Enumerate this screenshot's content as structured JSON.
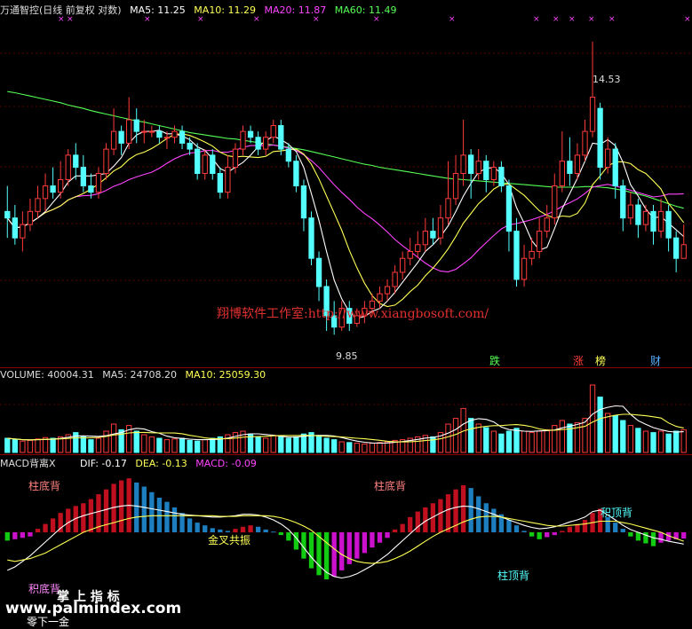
{
  "main_header": {
    "title": "万通智控(日线 前复权 对数)",
    "ma5": "MA5: 11.25",
    "ma10": "MA10: 11.29",
    "ma20": "MA20: 11.87",
    "ma60": "MA60: 11.49"
  },
  "volume_header": {
    "label": "VOLUME: 40004.31",
    "ma5": "MA5: 24708.20",
    "ma10": "MA10: 25059.30"
  },
  "macd_header": {
    "label": "MACD背离X",
    "dif": "DIF: -0.17",
    "dea": "DEA: -0.13",
    "macd": "MACD: -0.09"
  },
  "annotations": {
    "high_price": "14.53",
    "low_price": "9.85",
    "watermark": "翔博软件工作室:http://www.xiangbosoft.com/",
    "tag_die": "跌",
    "tag_zhang": "涨",
    "tag_bang": "榜",
    "tag_cai": "财",
    "zhu_di_bei_1": "柱底背",
    "zhu_di_bei_2": "柱底背",
    "jin_cha_gong_zhen": "金叉共振",
    "zhu_ding_bei": "柱顶背",
    "ji_ding_bei": "积顶背",
    "ji_di_bei": "积底背",
    "logo_text": "掌 上 指 标",
    "site": "www.palmindex.com",
    "bottom_text": "零下一金"
  },
  "colors": {
    "up": "#ff3b3b",
    "down": "#54ffff",
    "ma5": "#ffffff",
    "ma10": "#ffff55",
    "ma20": "#ff44ff",
    "ma60": "#55ff55",
    "macd_red": "#c01020",
    "macd_blue": "#1e7fc0",
    "macd_green": "#11cc11",
    "macd_purple": "#cc11cc"
  },
  "chart_data": {
    "type": "candlestick",
    "scale": "log",
    "y_range": [
      9.5,
      15.0
    ],
    "candles": [
      [
        11.6,
        11.5,
        12.0,
        11.2
      ],
      [
        11.5,
        11.2,
        11.7,
        11.1
      ],
      [
        11.2,
        11.4,
        11.6,
        11.0
      ],
      [
        11.4,
        11.6,
        11.8,
        11.3
      ],
      [
        11.6,
        11.8,
        12.0,
        11.5
      ],
      [
        11.8,
        12.0,
        12.2,
        11.6
      ],
      [
        12.0,
        11.9,
        12.3,
        11.8
      ],
      [
        11.9,
        12.1,
        12.4,
        11.8
      ],
      [
        12.1,
        12.5,
        12.6,
        12.0
      ],
      [
        12.5,
        12.3,
        12.7,
        12.1
      ],
      [
        12.3,
        12.0,
        12.5,
        11.9
      ],
      [
        12.0,
        11.9,
        12.2,
        11.8
      ],
      [
        11.9,
        12.2,
        12.3,
        11.8
      ],
      [
        12.2,
        12.6,
        12.7,
        12.1
      ],
      [
        12.6,
        12.9,
        13.3,
        12.5
      ],
      [
        12.9,
        12.7,
        13.0,
        12.5
      ],
      [
        12.7,
        13.1,
        13.5,
        12.6
      ],
      [
        13.1,
        12.9,
        13.3,
        12.7
      ],
      [
        12.9,
        12.9,
        13.1,
        12.7
      ],
      [
        12.9,
        12.9,
        13.0,
        12.8
      ],
      [
        12.9,
        12.8,
        13.0,
        12.7
      ],
      [
        12.8,
        12.8,
        12.9,
        12.6
      ],
      [
        12.8,
        12.9,
        13.0,
        12.7
      ],
      [
        12.9,
        12.7,
        13.0,
        12.6
      ],
      [
        12.7,
        12.6,
        12.8,
        12.5
      ],
      [
        12.6,
        12.2,
        12.7,
        12.1
      ],
      [
        12.2,
        12.5,
        12.6,
        12.1
      ],
      [
        12.5,
        12.2,
        12.6,
        12.1
      ],
      [
        12.2,
        11.9,
        12.3,
        11.8
      ],
      [
        11.9,
        12.3,
        12.5,
        11.8
      ],
      [
        12.3,
        12.6,
        12.7,
        12.2
      ],
      [
        12.6,
        12.9,
        13.0,
        12.5
      ],
      [
        12.9,
        12.8,
        13.0,
        12.7
      ],
      [
        12.8,
        12.6,
        12.9,
        12.5
      ],
      [
        12.6,
        12.8,
        12.9,
        12.5
      ],
      [
        12.8,
        13.0,
        13.1,
        12.7
      ],
      [
        13.0,
        12.6,
        13.1,
        12.5
      ],
      [
        12.6,
        12.4,
        12.7,
        12.3
      ],
      [
        12.4,
        12.0,
        12.5,
        11.9
      ],
      [
        12.0,
        11.5,
        12.1,
        11.3
      ],
      [
        11.5,
        10.9,
        11.6,
        10.8
      ],
      [
        10.9,
        10.5,
        11.0,
        10.3
      ],
      [
        10.5,
        10.1,
        10.6,
        9.9
      ],
      [
        10.1,
        9.95,
        10.3,
        9.85
      ],
      [
        9.95,
        10.2,
        10.3,
        9.9
      ],
      [
        10.2,
        10.0,
        10.3,
        9.9
      ],
      [
        10.0,
        10.1,
        10.2,
        9.95
      ],
      [
        10.1,
        10.2,
        10.3,
        10.0
      ],
      [
        10.2,
        10.3,
        10.4,
        10.1
      ],
      [
        10.3,
        10.4,
        10.5,
        10.2
      ],
      [
        10.4,
        10.5,
        10.6,
        10.3
      ],
      [
        10.5,
        10.7,
        10.8,
        10.4
      ],
      [
        10.7,
        10.9,
        11.0,
        10.6
      ],
      [
        10.9,
        11.0,
        11.2,
        10.8
      ],
      [
        11.0,
        11.1,
        11.3,
        10.9
      ],
      [
        11.1,
        11.3,
        11.5,
        11.0
      ],
      [
        11.3,
        11.2,
        11.5,
        11.1
      ],
      [
        11.2,
        11.5,
        11.7,
        11.1
      ],
      [
        11.5,
        11.8,
        12.4,
        11.4
      ],
      [
        11.8,
        12.2,
        12.5,
        11.7
      ],
      [
        12.2,
        12.5,
        13.1,
        12.0
      ],
      [
        12.5,
        12.2,
        12.6,
        11.8
      ],
      [
        12.2,
        12.4,
        12.6,
        12.1
      ],
      [
        12.4,
        12.1,
        12.5,
        11.9
      ],
      [
        12.1,
        12.3,
        12.4,
        12.0
      ],
      [
        12.3,
        12.0,
        12.4,
        11.9
      ],
      [
        12.0,
        11.3,
        12.1,
        11.0
      ],
      [
        11.3,
        10.6,
        11.5,
        10.5
      ],
      [
        10.6,
        10.9,
        11.1,
        10.5
      ],
      [
        10.9,
        11.0,
        11.2,
        10.8
      ],
      [
        11.0,
        11.3,
        11.5,
        10.9
      ],
      [
        11.3,
        11.5,
        11.7,
        11.2
      ],
      [
        11.5,
        12.0,
        12.2,
        11.4
      ],
      [
        12.0,
        12.4,
        12.9,
        11.9
      ],
      [
        12.4,
        12.2,
        12.8,
        12.0
      ],
      [
        12.2,
        12.5,
        12.7,
        12.1
      ],
      [
        12.5,
        12.9,
        13.1,
        12.4
      ],
      [
        12.9,
        13.5,
        14.53,
        12.8
      ],
      [
        13.3,
        12.3,
        13.4,
        12.1
      ],
      [
        12.3,
        12.6,
        12.8,
        12.2
      ],
      [
        12.6,
        12.0,
        12.7,
        11.8
      ],
      [
        12.0,
        11.5,
        12.1,
        11.3
      ],
      [
        11.5,
        11.7,
        11.9,
        11.4
      ],
      [
        11.7,
        11.4,
        11.8,
        11.2
      ],
      [
        11.4,
        11.6,
        11.7,
        11.3
      ],
      [
        11.6,
        11.3,
        11.7,
        11.1
      ],
      [
        11.3,
        11.6,
        11.8,
        11.2
      ],
      [
        11.6,
        11.2,
        11.7,
        11.0
      ],
      [
        11.2,
        10.9,
        11.3,
        10.7
      ],
      [
        10.9,
        11.1,
        11.4,
        10.9
      ]
    ],
    "ma60": [
      13.6,
      13.58,
      13.55,
      13.52,
      13.49,
      13.46,
      13.43,
      13.4,
      13.36,
      13.33,
      13.3,
      13.26,
      13.23,
      13.2,
      13.17,
      13.14,
      13.11,
      13.08,
      13.06,
      13.03,
      13.0,
      12.97,
      12.94,
      12.91,
      12.88,
      12.86,
      12.84,
      12.82,
      12.8,
      12.78,
      12.77,
      12.75,
      12.73,
      12.71,
      12.69,
      12.67,
      12.65,
      12.63,
      12.61,
      12.59,
      12.56,
      12.53,
      12.5,
      12.47,
      12.44,
      12.41,
      12.38,
      12.35,
      12.33,
      12.3,
      12.28,
      12.26,
      12.24,
      12.22,
      12.2,
      12.18,
      12.16,
      12.14,
      12.12,
      12.11,
      12.1,
      12.09,
      12.08,
      12.07,
      12.06,
      12.05,
      12.04,
      12.03,
      12.02,
      12.01,
      12.0,
      11.99,
      11.98,
      11.98,
      11.98,
      11.98,
      11.99,
      11.99,
      11.98,
      11.97,
      11.95,
      11.93,
      11.9,
      11.87,
      11.84,
      11.8,
      11.76,
      11.72,
      11.68,
      11.65
    ],
    "volume": [
      0.2,
      0.18,
      0.16,
      0.17,
      0.19,
      0.21,
      0.2,
      0.22,
      0.25,
      0.28,
      0.22,
      0.18,
      0.2,
      0.3,
      0.4,
      0.32,
      0.38,
      0.3,
      0.25,
      0.22,
      0.2,
      0.18,
      0.19,
      0.2,
      0.17,
      0.16,
      0.18,
      0.2,
      0.22,
      0.25,
      0.28,
      0.3,
      0.26,
      0.22,
      0.2,
      0.24,
      0.22,
      0.2,
      0.22,
      0.26,
      0.28,
      0.24,
      0.2,
      0.18,
      0.15,
      0.14,
      0.13,
      0.12,
      0.13,
      0.14,
      0.15,
      0.17,
      0.18,
      0.2,
      0.22,
      0.24,
      0.22,
      0.28,
      0.4,
      0.48,
      0.62,
      0.48,
      0.4,
      0.35,
      0.3,
      0.26,
      0.3,
      0.34,
      0.3,
      0.28,
      0.3,
      0.32,
      0.38,
      0.45,
      0.4,
      0.42,
      0.48,
      0.95,
      0.78,
      0.55,
      0.52,
      0.45,
      0.38,
      0.34,
      0.3,
      0.28,
      0.3,
      0.26,
      0.3,
      0.32
    ],
    "macd": [
      -0.12,
      -0.1,
      -0.08,
      -0.06,
      0.05,
      0.12,
      0.2,
      0.28,
      0.34,
      0.38,
      0.42,
      0.48,
      0.55,
      0.62,
      0.7,
      0.75,
      0.78,
      0.72,
      0.66,
      0.58,
      0.5,
      0.44,
      0.36,
      0.28,
      0.2,
      0.14,
      0.1,
      0.06,
      0.04,
      0.02,
      0.05,
      0.08,
      0.1,
      0.08,
      0.04,
      0.01,
      -0.04,
      -0.12,
      -0.25,
      -0.38,
      -0.52,
      -0.62,
      -0.68,
      -0.64,
      -0.55,
      -0.46,
      -0.38,
      -0.3,
      -0.22,
      -0.15,
      -0.08,
      0.04,
      0.12,
      0.22,
      0.3,
      0.36,
      0.42,
      0.48,
      0.55,
      0.62,
      0.68,
      0.64,
      0.52,
      0.42,
      0.34,
      0.26,
      0.18,
      0.1,
      0.02,
      -0.06,
      -0.1,
      -0.07,
      -0.04,
      0.02,
      0.08,
      0.12,
      0.18,
      0.28,
      0.34,
      0.22,
      0.14,
      0.05,
      -0.06,
      -0.12,
      -0.16,
      -0.2,
      -0.15,
      -0.12,
      -0.1,
      -0.09
    ],
    "dif": [
      -0.55,
      -0.5,
      -0.42,
      -0.34,
      -0.24,
      -0.14,
      -0.04,
      0.06,
      0.14,
      0.2,
      0.24,
      0.27,
      0.3,
      0.33,
      0.36,
      0.38,
      0.39,
      0.38,
      0.36,
      0.34,
      0.32,
      0.3,
      0.28,
      0.26,
      0.25,
      0.24,
      0.23,
      0.22,
      0.22,
      0.23,
      0.24,
      0.26,
      0.26,
      0.25,
      0.22,
      0.18,
      0.12,
      0.04,
      -0.08,
      -0.22,
      -0.36,
      -0.48,
      -0.58,
      -0.64,
      -0.66,
      -0.64,
      -0.6,
      -0.54,
      -0.48,
      -0.4,
      -0.32,
      -0.22,
      -0.12,
      -0.02,
      0.08,
      0.16,
      0.22,
      0.28,
      0.33,
      0.36,
      0.38,
      0.37,
      0.34,
      0.3,
      0.26,
      0.22,
      0.18,
      0.14,
      0.1,
      0.07,
      0.05,
      0.06,
      0.08,
      0.11,
      0.15,
      0.18,
      0.22,
      0.3,
      0.32,
      0.25,
      0.18,
      0.1,
      0.04,
      0.0,
      -0.04,
      -0.08,
      -0.1,
      -0.13,
      -0.15,
      -0.17
    ],
    "dea": [
      -0.4,
      -0.42,
      -0.4,
      -0.38,
      -0.34,
      -0.3,
      -0.24,
      -0.18,
      -0.12,
      -0.06,
      0.0,
      0.04,
      0.08,
      0.11,
      0.14,
      0.17,
      0.2,
      0.22,
      0.23,
      0.24,
      0.24,
      0.24,
      0.24,
      0.24,
      0.24,
      0.24,
      0.24,
      0.24,
      0.23,
      0.23,
      0.23,
      0.24,
      0.24,
      0.24,
      0.24,
      0.23,
      0.21,
      0.18,
      0.14,
      0.09,
      0.03,
      -0.06,
      -0.15,
      -0.24,
      -0.32,
      -0.38,
      -0.42,
      -0.44,
      -0.45,
      -0.44,
      -0.42,
      -0.38,
      -0.33,
      -0.27,
      -0.2,
      -0.13,
      -0.06,
      0.0,
      0.05,
      0.1,
      0.15,
      0.19,
      0.22,
      0.23,
      0.23,
      0.22,
      0.2,
      0.18,
      0.16,
      0.14,
      0.12,
      0.1,
      0.09,
      0.09,
      0.1,
      0.11,
      0.12,
      0.14,
      0.16,
      0.16,
      0.16,
      0.14,
      0.12,
      0.09,
      0.06,
      0.03,
      0.0,
      -0.05,
      -0.09,
      -0.13
    ]
  }
}
